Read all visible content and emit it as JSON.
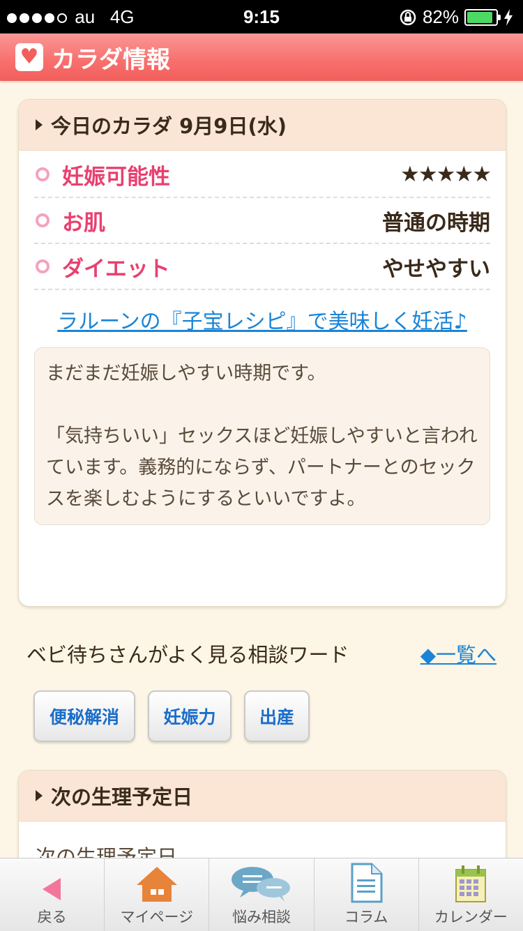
{
  "status": {
    "carrier": "au",
    "network": "4G",
    "time": "9:15",
    "battery": "82%"
  },
  "header": {
    "title": "カラダ情報",
    "icon": "heart-icon"
  },
  "today": {
    "title": "今日のカラダ 9月9日(水)",
    "rows": [
      {
        "label": "妊娠可能性",
        "value": "★★★★★",
        "rating": 5
      },
      {
        "label": "お肌",
        "value": "普通の時期"
      },
      {
        "label": "ダイエット",
        "value": "やせやすい"
      }
    ],
    "link": "ラルーンの『子宝レシピ』で美味しく妊活♪",
    "desc": {
      "p1": "まだまだ妊娠しやすい時期です。",
      "p2": "「気持ちいい」セックスほど妊娠しやすいと言われています。義務的にならず、パートナーとのセックスを楽しむようにするといいですよ。"
    }
  },
  "words": {
    "title": "ベビ待ちさんがよく見る相談ワード",
    "more": "◆一覧へ",
    "tags": [
      "便秘解消",
      "妊娠力",
      "出産"
    ]
  },
  "next": {
    "title": "次の生理予定日",
    "subtitle": "次の生理予定日"
  },
  "tabs": [
    {
      "label": "戻る",
      "icon": "back-arrow-icon"
    },
    {
      "label": "マイページ",
      "icon": "house-icon"
    },
    {
      "label": "悩み相談",
      "icon": "chat-bubbles-icon"
    },
    {
      "label": "コラム",
      "icon": "document-icon"
    },
    {
      "label": "カレンダー",
      "icon": "calendar-icon"
    }
  ]
}
